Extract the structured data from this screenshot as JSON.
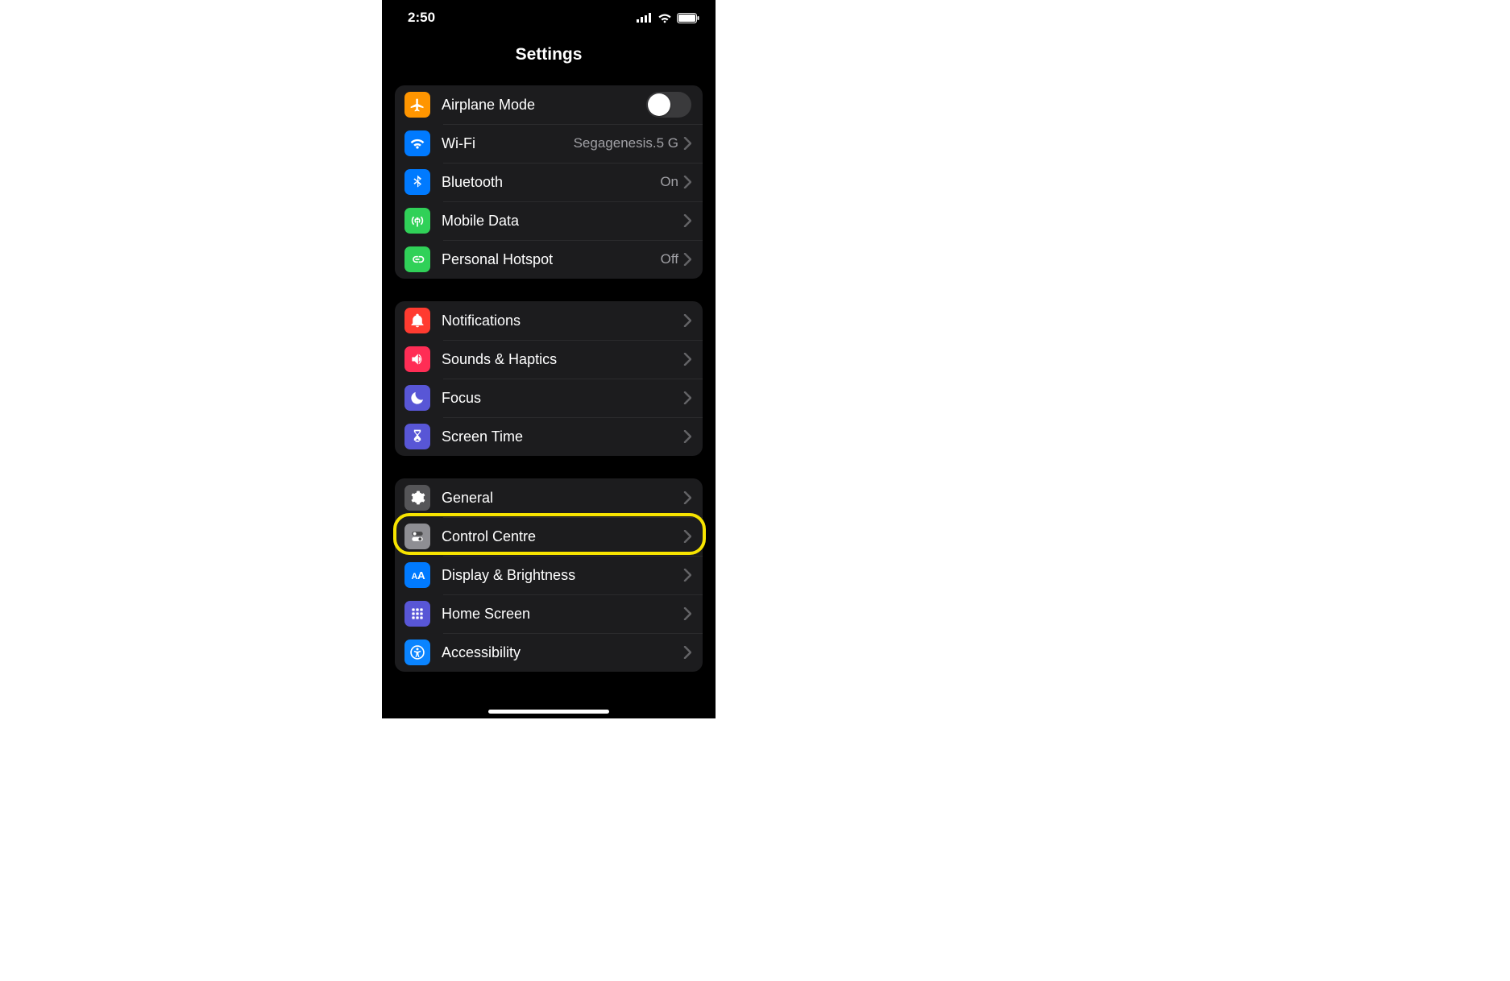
{
  "status_bar": {
    "time": "2:50"
  },
  "header": {
    "title": "Settings"
  },
  "groups": [
    {
      "rows": [
        {
          "id": "airplane",
          "icon": "airplane-icon",
          "icon_bg": "bg-orange",
          "label": "Airplane Mode",
          "value": "",
          "control": "toggle",
          "toggle_on": false
        },
        {
          "id": "wifi",
          "icon": "wifi-icon",
          "icon_bg": "bg-blue",
          "label": "Wi-Fi",
          "value": "Segagenesis.5 G",
          "control": "chevron"
        },
        {
          "id": "bluetooth",
          "icon": "bluetooth-icon",
          "icon_bg": "bg-blue",
          "label": "Bluetooth",
          "value": "On",
          "control": "chevron"
        },
        {
          "id": "mobile",
          "icon": "antenna-icon",
          "icon_bg": "bg-teal",
          "label": "Mobile Data",
          "value": "",
          "control": "chevron"
        },
        {
          "id": "hotspot",
          "icon": "link-icon",
          "icon_bg": "bg-link",
          "label": "Personal Hotspot",
          "value": "Off",
          "control": "chevron"
        }
      ]
    },
    {
      "rows": [
        {
          "id": "notifications",
          "icon": "bell-icon",
          "icon_bg": "bg-red",
          "label": "Notifications",
          "value": "",
          "control": "chevron"
        },
        {
          "id": "sounds",
          "icon": "speaker-icon",
          "icon_bg": "bg-pink",
          "label": "Sounds & Haptics",
          "value": "",
          "control": "chevron"
        },
        {
          "id": "focus",
          "icon": "moon-icon",
          "icon_bg": "bg-indigo",
          "label": "Focus",
          "value": "",
          "control": "chevron"
        },
        {
          "id": "screentime",
          "icon": "hourglass-icon",
          "icon_bg": "bg-indigo",
          "label": "Screen Time",
          "value": "",
          "control": "chevron"
        }
      ]
    },
    {
      "rows": [
        {
          "id": "general",
          "icon": "gear-icon",
          "icon_bg": "bg-darkgray",
          "label": "General",
          "value": "",
          "control": "chevron",
          "highlighted": true
        },
        {
          "id": "controlcentre",
          "icon": "switches-icon",
          "icon_bg": "bg-gray",
          "label": "Control Centre",
          "value": "",
          "control": "chevron"
        },
        {
          "id": "display",
          "icon": "text-size-icon",
          "icon_bg": "bg-blue",
          "label": "Display & Brightness",
          "value": "",
          "control": "chevron"
        },
        {
          "id": "homescreen",
          "icon": "grid-icon",
          "icon_bg": "bg-indigo",
          "label": "Home Screen",
          "value": "",
          "control": "chevron"
        },
        {
          "id": "accessibility",
          "icon": "accessibility-icon",
          "icon_bg": "bg-bluealt",
          "label": "Accessibility",
          "value": "",
          "control": "chevron"
        }
      ]
    }
  ]
}
